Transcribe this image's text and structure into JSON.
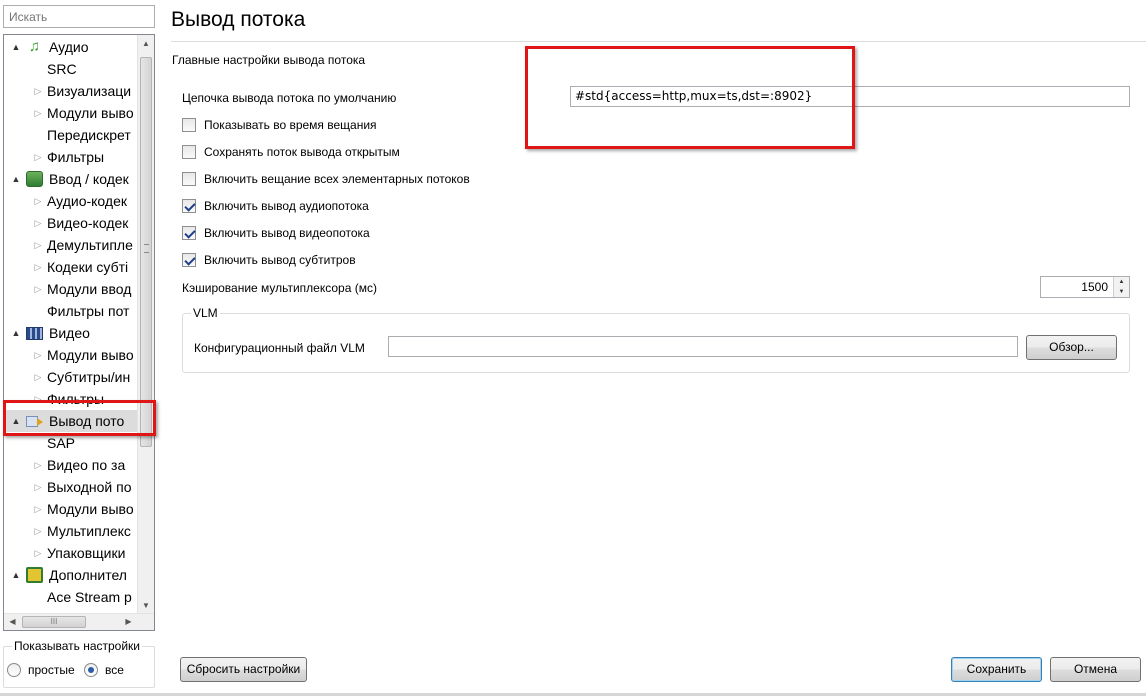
{
  "search": {
    "placeholder": "Искать"
  },
  "tree": {
    "items": [
      {
        "label": "Аудио",
        "level": 0,
        "expander": "▲",
        "icon": "music-note-icon"
      },
      {
        "label": "SRC",
        "level": 1,
        "expander": ""
      },
      {
        "label": "Визуализаци",
        "level": 1,
        "expander": "▷"
      },
      {
        "label": "Модули выво",
        "level": 1,
        "expander": "▷"
      },
      {
        "label": "Передискрет",
        "level": 1,
        "expander": ""
      },
      {
        "label": "Фильтры",
        "level": 1,
        "expander": "▷"
      },
      {
        "label": "Ввод / кодек",
        "level": 0,
        "expander": "▲",
        "icon": "input-codec-icon"
      },
      {
        "label": "Аудио-кодек",
        "level": 1,
        "expander": "▷"
      },
      {
        "label": "Видео-кодек",
        "level": 1,
        "expander": "▷"
      },
      {
        "label": "Демультипле",
        "level": 1,
        "expander": "▷"
      },
      {
        "label": "Кодеки субті",
        "level": 1,
        "expander": "▷"
      },
      {
        "label": "Модули ввод",
        "level": 1,
        "expander": "▷"
      },
      {
        "label": "Фильтры пот",
        "level": 1,
        "expander": ""
      },
      {
        "label": "Видео",
        "level": 0,
        "expander": "▲",
        "icon": "film-icon"
      },
      {
        "label": "Модули выво",
        "level": 1,
        "expander": "▷"
      },
      {
        "label": "Субтитры/ин",
        "level": 1,
        "expander": "▷"
      },
      {
        "label": "Фильтры",
        "level": 1,
        "expander": "▷"
      },
      {
        "label": "Вывод пото",
        "level": 0,
        "expander": "▲",
        "icon": "stream-output-icon",
        "selected": true
      },
      {
        "label": "SAP",
        "level": 1,
        "expander": ""
      },
      {
        "label": "Видео по за",
        "level": 1,
        "expander": "▷"
      },
      {
        "label": "Выходной по",
        "level": 1,
        "expander": "▷"
      },
      {
        "label": "Модули выво",
        "level": 1,
        "expander": "▷"
      },
      {
        "label": "Мультиплекс",
        "level": 1,
        "expander": "▷"
      },
      {
        "label": "Упаковщики",
        "level": 1,
        "expander": "▷"
      },
      {
        "label": "Дополнител",
        "level": 0,
        "expander": "▲",
        "icon": "chip-icon"
      },
      {
        "label": "Ace Stream p",
        "level": 1,
        "expander": ""
      }
    ],
    "scroll_up_glyph": "▲",
    "scroll_down_glyph": "▼",
    "scroll_left_glyph": "◀",
    "scroll_right_glyph": "▶",
    "hthumb_grip": "III"
  },
  "show_settings": {
    "title": "Показывать настройки",
    "simple_label": "простые",
    "all_label": "все",
    "selected": "все"
  },
  "page": {
    "title": "Вывод потока",
    "section": "Главные настройки вывода потока"
  },
  "settings": {
    "chain_label": "Цепочка вывода потока по умолчанию",
    "chain_value": "#std{access=http,mux=ts,dst=:8902}",
    "checkboxes": [
      {
        "label": "Показывать во время вещания",
        "checked": false
      },
      {
        "label": "Сохранять поток вывода открытым",
        "checked": false
      },
      {
        "label": "Включить вещание всех элементарных потоков",
        "checked": false
      },
      {
        "label": "Включить вывод аудиопотока",
        "checked": true
      },
      {
        "label": "Включить вывод видеопотока",
        "checked": true
      },
      {
        "label": "Включить вывод субтитров",
        "checked": true
      }
    ],
    "cache_label": "Кэширование мультиплексора (мс)",
    "cache_value": "1500",
    "vlm": {
      "group_title": "VLM",
      "file_label": "Конфигурационный файл VLM",
      "file_value": "",
      "browse_label": "Обзор..."
    }
  },
  "buttons": {
    "reset": "Сбросить настройки",
    "save": "Сохранить",
    "cancel": "Отмена"
  },
  "colors": {
    "annotation": "#e01515",
    "selection": "#dcdcdc",
    "default_button_border": "#3c7fb1"
  }
}
